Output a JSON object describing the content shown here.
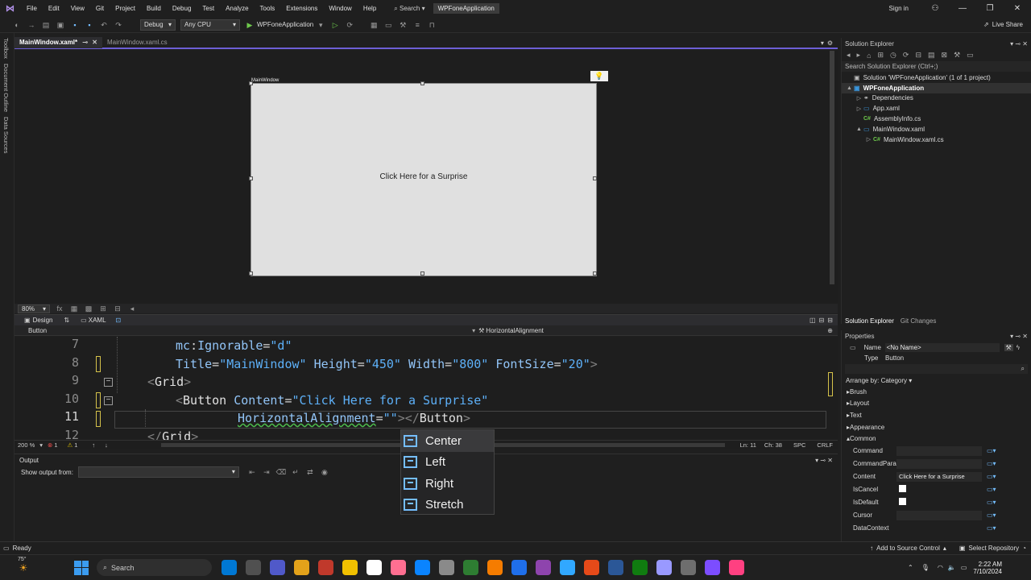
{
  "menubar": {
    "items": [
      "File",
      "Edit",
      "View",
      "Git",
      "Project",
      "Build",
      "Debug",
      "Test",
      "Analyze",
      "Tools",
      "Extensions",
      "Window",
      "Help"
    ],
    "search_label": "Search",
    "project_badge": "WPFoneApplication",
    "signin": "Sign in",
    "live_share": "Live Share"
  },
  "toolbar": {
    "config": "Debug",
    "platform": "Any CPU",
    "run_target": "WPFoneApplication"
  },
  "leftrail": [
    "Toolbox",
    "Document Outline",
    "Data Sources"
  ],
  "doc_tabs": [
    {
      "label": "MainWindow.xaml*",
      "active": true
    },
    {
      "label": "MainWindow.xaml.cs",
      "active": false
    }
  ],
  "designer": {
    "window_title": "MainWindow",
    "button_content": "Click Here for a Surprise",
    "zoom": "80%"
  },
  "view_tabs": {
    "design": "Design",
    "xaml": "XAML"
  },
  "breadcrumb": {
    "left": "Button",
    "right": "HorizontalAlignment"
  },
  "code": {
    "lines": [
      {
        "num": "7",
        "indent": 200,
        "parts": [
          [
            "attr",
            "mc"
          ],
          [
            "eq",
            ":"
          ],
          [
            "attr",
            "Ignorable"
          ],
          [
            "eq",
            "="
          ],
          [
            "str",
            "\"d\""
          ]
        ]
      },
      {
        "num": "8",
        "indent": 200,
        "parts": [
          [
            "attr",
            "Title"
          ],
          [
            "eq",
            "="
          ],
          [
            "str",
            "\"MainWindow\""
          ],
          [
            "eq",
            " "
          ],
          [
            "attr",
            "Height"
          ],
          [
            "eq",
            "="
          ],
          [
            "str",
            "\"450\""
          ],
          [
            "eq",
            " "
          ],
          [
            "attr",
            "Width"
          ],
          [
            "eq",
            "="
          ],
          [
            "str",
            "\"800\""
          ],
          [
            "eq",
            " "
          ],
          [
            "attr",
            "FontSize"
          ],
          [
            "eq",
            "="
          ],
          [
            "str",
            "\"20\""
          ],
          [
            "tag",
            ">"
          ]
        ]
      },
      {
        "num": "9",
        "indent": 165,
        "parts": [
          [
            "tag",
            "<"
          ],
          [
            "ktag",
            "Grid"
          ],
          [
            "tag",
            ">"
          ]
        ]
      },
      {
        "num": "10",
        "indent": 200,
        "parts": [
          [
            "tag",
            "<"
          ],
          [
            "ktag",
            "Button"
          ],
          [
            "eq",
            " "
          ],
          [
            "attr",
            "Content"
          ],
          [
            "eq",
            "="
          ],
          [
            "str",
            "\"Click Here for a Surprise\""
          ]
        ]
      },
      {
        "num": "11",
        "indent": 277,
        "parts": [
          [
            "attr",
            "HorizontalAlignment"
          ],
          [
            "eq",
            "="
          ],
          [
            "str",
            "\"\""
          ],
          [
            "tag",
            "></"
          ],
          [
            "ktag",
            "Button"
          ],
          [
            "tag",
            ">"
          ]
        ]
      },
      {
        "num": "12",
        "indent": 165,
        "parts": [
          [
            "tag",
            "</"
          ],
          [
            "ktag",
            "Grid"
          ],
          [
            "tag",
            ">"
          ]
        ]
      }
    ]
  },
  "editor_status": {
    "zoom": "200 %",
    "errors": "1",
    "warnings": "1",
    "line": "Ln: 11",
    "col": "Ch: 38",
    "spc": "SPC",
    "crlf": "CRLF"
  },
  "intellisense": [
    "Center",
    "Left",
    "Right",
    "Stretch"
  ],
  "output": {
    "title": "Output",
    "show_from": "Show output from:"
  },
  "solution": {
    "title": "Solution Explorer",
    "search_placeholder": "Search Solution Explorer (Ctrl+;)",
    "items": [
      {
        "label": "Solution 'WPFoneApplication' (1 of 1 project)",
        "level": 0,
        "icon": "solution-icon",
        "arrow": ""
      },
      {
        "label": "WPFoneApplication",
        "level": 0,
        "icon": "csproj-icon",
        "arrow": "▲",
        "selected": true
      },
      {
        "label": "Dependencies",
        "level": 1,
        "icon": "dependencies-icon",
        "arrow": "▷"
      },
      {
        "label": "App.xaml",
        "level": 1,
        "icon": "xaml-file-icon",
        "arrow": "▷"
      },
      {
        "label": "AssemblyInfo.cs",
        "level": 1,
        "icon": "cs-file-icon",
        "arrow": ""
      },
      {
        "label": "MainWindow.xaml",
        "level": 1,
        "icon": "xaml-file-icon",
        "arrow": "▲"
      },
      {
        "label": "MainWindow.xaml.cs",
        "level": 2,
        "icon": "cs-file-icon",
        "arrow": "▷"
      }
    ],
    "bottom_tabs": [
      "Solution Explorer",
      "Git Changes"
    ]
  },
  "properties": {
    "title": "Properties",
    "name_label": "Name",
    "name_value": "<No Name>",
    "type_label": "Type",
    "type_value": "Button",
    "arrange_by": "Arrange by: Category",
    "categories": [
      "Brush",
      "Layout",
      "Text",
      "Appearance",
      "Common"
    ],
    "common_props": [
      {
        "name": "Command",
        "value": "",
        "kind": "text"
      },
      {
        "name": "CommandPara...",
        "value": "",
        "kind": "text"
      },
      {
        "name": "Content",
        "value": "Click Here for a Surprise",
        "kind": "text"
      },
      {
        "name": "IsCancel",
        "value": "",
        "kind": "check"
      },
      {
        "name": "IsDefault",
        "value": "",
        "kind": "check"
      },
      {
        "name": "Cursor",
        "value": "",
        "kind": "text"
      },
      {
        "name": "DataContext",
        "value": "",
        "kind": "none"
      }
    ]
  },
  "statusbar": {
    "ready": "Ready",
    "source_control": "Add to Source Control",
    "select_repo": "Select Repository"
  },
  "taskbar": {
    "weather": "75°",
    "search": "Search",
    "time": "2:22 AM",
    "date": "7/10/2024",
    "apps": [
      "#0078d4",
      "#505050",
      "#5059c9",
      "#e3a21a",
      "#c0392b",
      "#f0c000",
      "#ffffff",
      "#ff6f91",
      "#0a84ff",
      "#8a8a8a",
      "#2e7d32",
      "#f57c00",
      "#1f6feb",
      "#8e44ad",
      "#31a8ff",
      "#e64a19",
      "#2b5797",
      "#107c10",
      "#9999ff",
      "#6e6e6e",
      "#7c4dff",
      "#ff4081"
    ]
  }
}
